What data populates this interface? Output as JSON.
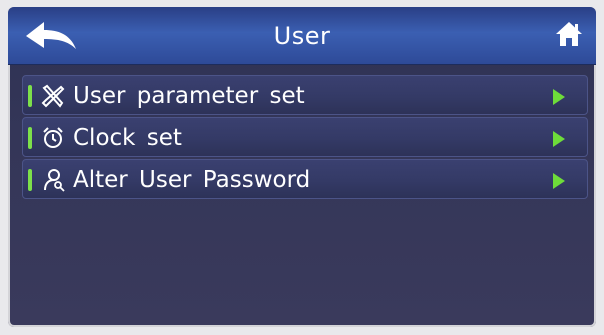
{
  "header": {
    "title": "User",
    "back_icon": "back-arrow-icon",
    "home_icon": "home-icon"
  },
  "menu": {
    "items": [
      {
        "label": "User parameter set",
        "icon": "tools-icon"
      },
      {
        "label": "Clock set",
        "icon": "alarm-clock-icon"
      },
      {
        "label": "Alter User Password",
        "icon": "user-key-icon"
      }
    ]
  },
  "colors": {
    "header": "#3b5fb2",
    "background": "#343658",
    "accent": "#6edc3a",
    "text": "#ffffff"
  }
}
